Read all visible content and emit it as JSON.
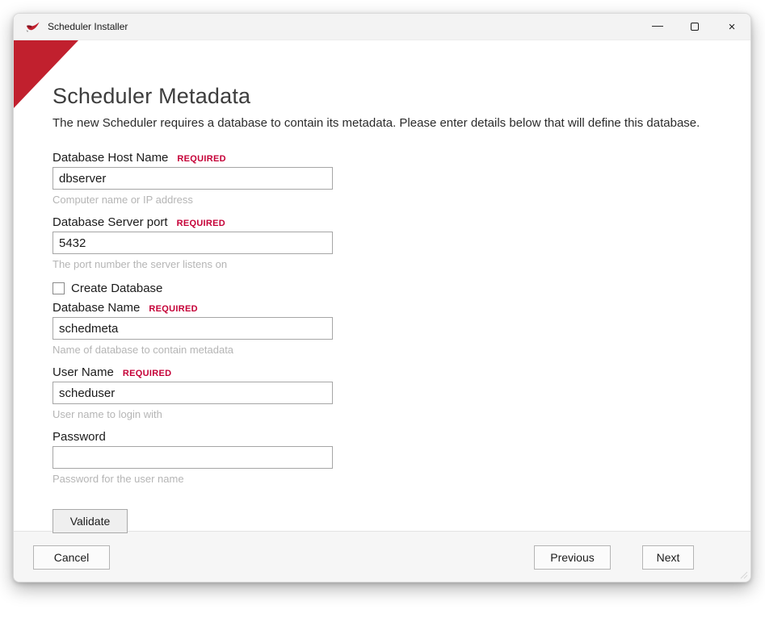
{
  "titlebar": {
    "title": "Scheduler Installer",
    "minimize_icon": "—",
    "close_icon": "×"
  },
  "page": {
    "heading": "Scheduler Metadata",
    "description": "The new Scheduler requires a database to contain its metadata. Please enter details below that will define this database."
  },
  "form": {
    "required_badge": "REQUIRED",
    "fields": [
      {
        "label": "Database Host Name",
        "value": "dbserver",
        "hint": "Computer name or IP address"
      },
      {
        "label": "Database Server port",
        "value": "5432",
        "hint": "The port number the server listens on"
      },
      {
        "label": "Database Name",
        "value": "schedmeta",
        "hint": "Name of database to contain metadata"
      },
      {
        "label": "User Name",
        "value": "scheduser",
        "hint": "User name to login with"
      },
      {
        "label": "Password",
        "value": "",
        "hint": "Password for the user name"
      }
    ],
    "create_database_checkbox": {
      "label": "Create Database",
      "checked": false
    },
    "validate_button_label": "Validate"
  },
  "footer": {
    "cancel_label": "Cancel",
    "previous_label": "Previous",
    "next_label": "Next"
  },
  "colors": {
    "accent_red": "#c1202e",
    "required_red": "#c50037",
    "titlebar_bg": "#f3f3f3",
    "footer_bg": "#f6f6f6"
  }
}
